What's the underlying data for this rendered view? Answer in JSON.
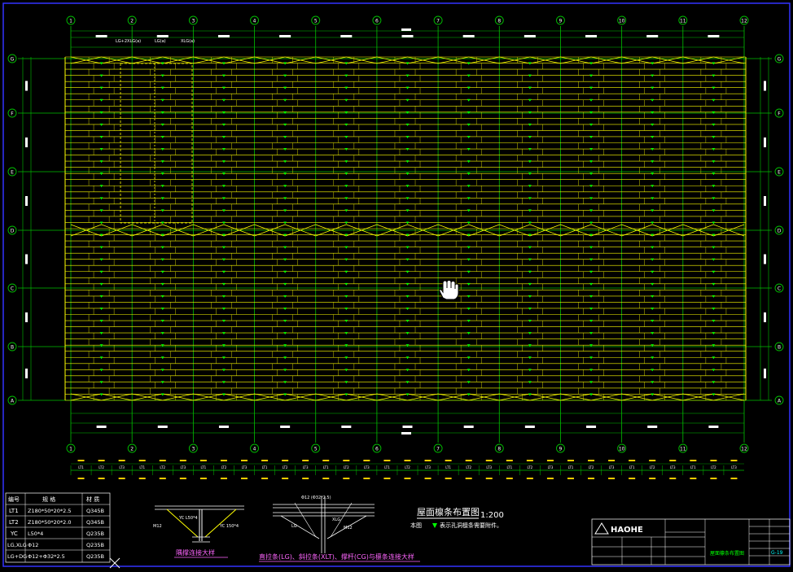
{
  "drawing": {
    "columns": [
      "1",
      "2",
      "3",
      "4",
      "5",
      "6",
      "7",
      "8",
      "9",
      "10",
      "11",
      "12"
    ],
    "rows": [
      "A",
      "B",
      "C",
      "D",
      "E",
      "F",
      "G"
    ],
    "top_labels": [
      "LG+2XLG(a)",
      "LG(a)",
      "XLG(a)"
    ],
    "scale_title": "屋面檩条布置图",
    "scale_value": "1:200",
    "note_prefix": "本图",
    "note_text": "表示孔洞檩条需要附件。",
    "purlin_labels": [
      "LT1",
      "LT2",
      "LT3"
    ]
  },
  "colors": {
    "background": "#000000",
    "grid": "#00c000",
    "purlin": "#ffff00",
    "marker": "#00ff00",
    "dimension": "#ffffff",
    "frame": "#3333ff",
    "text": "#ffffff"
  },
  "material_table": {
    "headers": [
      "编号",
      "规 格",
      "材 质"
    ],
    "rows": [
      {
        "code": "LT1",
        "spec": "Z180*50*20*2.5",
        "material": "Q345B"
      },
      {
        "code": "LT2",
        "spec": "Z180*50*20*2.0",
        "material": "Q345B"
      },
      {
        "code": "YC",
        "spec": "L50*4",
        "material": "Q235B"
      },
      {
        "code": "LG,XLG",
        "spec": "Φ12",
        "material": "Q235B"
      },
      {
        "code": "LG+DG",
        "spec": "Φ12+Φ32*2.5",
        "material": "Q235B"
      }
    ]
  },
  "details": {
    "detail1_title": "隅撑连接大样",
    "detail2_title": "直拉条(LG)、斜拉条(XLT)、撑杆(CG)与檩条连接大样",
    "detail1_labels": [
      "YC L50*4",
      "M12",
      "YC 150*4"
    ],
    "detail2_labels": [
      "Φ12 (Φ32*2.5)",
      "M12",
      "LG",
      "XLG"
    ]
  },
  "title_block": {
    "company": "HAOHE",
    "drawing_name": "屋面檩条布置图",
    "sheet_no": "G-19"
  },
  "icons": {
    "cursor": "hand-cursor-icon",
    "pointer": "x-cursor-icon"
  }
}
